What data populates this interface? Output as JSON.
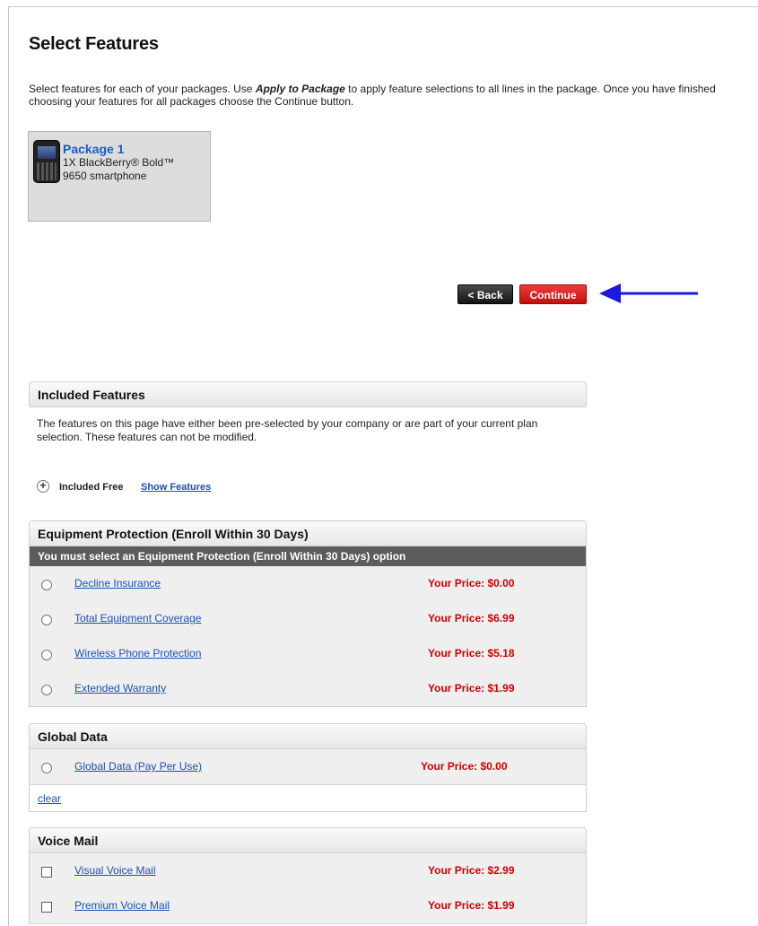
{
  "page": {
    "title": "Select Features",
    "intro_before": "Select features for each of your packages. Use ",
    "intro_em": "Apply to Package",
    "intro_after": " to apply feature selections to all lines in the package. Once you have finished choosing your features for all packages choose the Continue button."
  },
  "package": {
    "name": "Package 1",
    "line1": "1X  BlackBerry® Bold™",
    "line2": "9650 smartphone"
  },
  "nav": {
    "back_label": "< Back",
    "continue_label": "Continue"
  },
  "included": {
    "heading": "Included Features",
    "text": "The features on this page have either been pre-selected by your company or are part of your current plan selection. These features can not be modified.",
    "toggle": "+",
    "free_label": "Included Free",
    "show_link": "Show Features"
  },
  "equipment": {
    "heading": "Equipment Protection (Enroll Within 30 Days)",
    "note": "You must select an Equipment Protection (Enroll Within 30 Days) option",
    "options": [
      {
        "label": "Decline Insurance",
        "price": "Your Price: $0.00"
      },
      {
        "label": "Total Equipment Coverage",
        "price": "Your Price: $6.99"
      },
      {
        "label": "Wireless Phone Protection",
        "price": "Your Price: $5.18"
      },
      {
        "label": "Extended Warranty",
        "price": "Your Price: $1.99"
      }
    ]
  },
  "global": {
    "heading": "Global Data",
    "options": [
      {
        "label": "Global Data (Pay Per Use)",
        "price": "Your Price: $0.00"
      }
    ],
    "clear": "clear"
  },
  "voicemail": {
    "heading": "Voice Mail",
    "options": [
      {
        "label": "Visual Voice Mail",
        "price": "Your Price: $2.99"
      },
      {
        "label": "Premium Voice Mail",
        "price": "Your Price: $1.99"
      }
    ]
  },
  "colors": {
    "accent_red": "#d20000",
    "link_blue": "#1d4fb5",
    "arrow_blue": "#1a1adb"
  }
}
